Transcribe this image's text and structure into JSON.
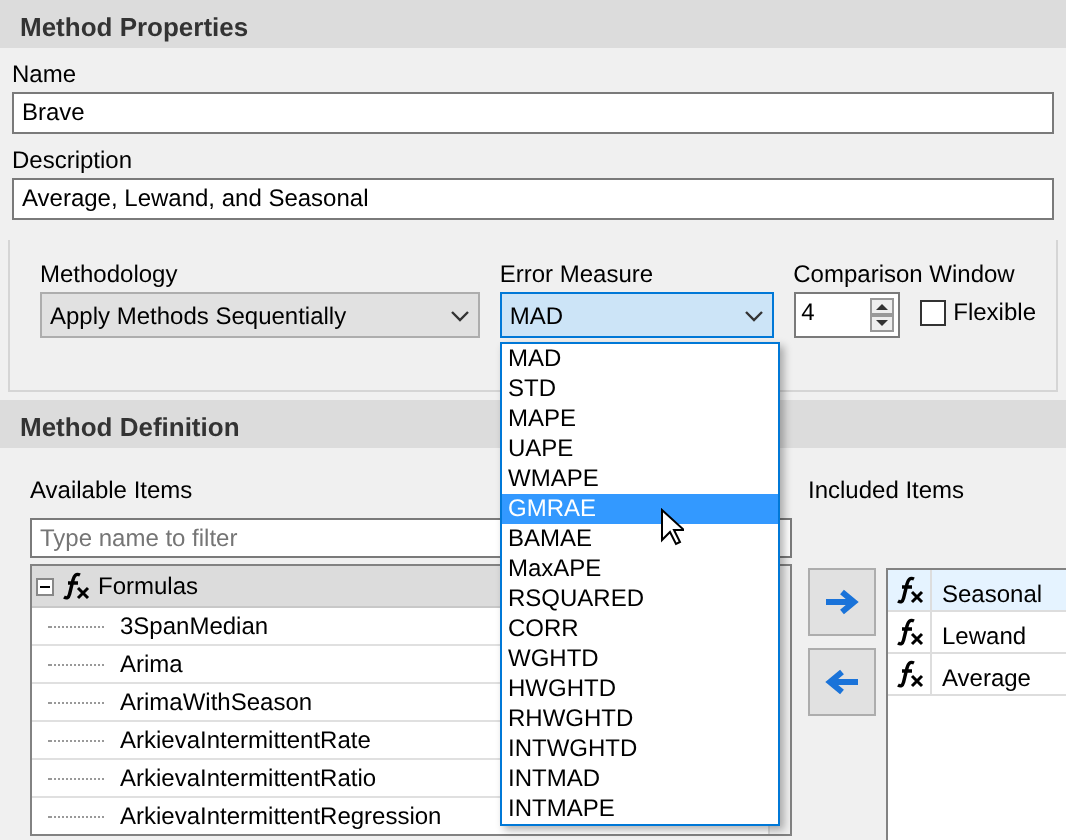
{
  "properties": {
    "title": "Method Properties",
    "name": {
      "label": "Name",
      "value": "Brave"
    },
    "description": {
      "label": "Description",
      "value": "Average, Lewand, and Seasonal"
    },
    "methodology": {
      "label": "Methodology",
      "value": "Apply Methods Sequentially"
    },
    "error_measure": {
      "label": "Error Measure",
      "value": "MAD",
      "expanded": true,
      "options": [
        {
          "label": "MAD",
          "highlighted": false
        },
        {
          "label": "STD",
          "highlighted": false
        },
        {
          "label": "MAPE",
          "highlighted": false
        },
        {
          "label": "UAPE",
          "highlighted": false
        },
        {
          "label": "WMAPE",
          "highlighted": false
        },
        {
          "label": "GMRAE",
          "highlighted": true
        },
        {
          "label": "BAMAE",
          "highlighted": false
        },
        {
          "label": "MaxAPE",
          "highlighted": false
        },
        {
          "label": "RSQUARED",
          "highlighted": false
        },
        {
          "label": "CORR",
          "highlighted": false
        },
        {
          "label": "WGHTD",
          "highlighted": false
        },
        {
          "label": "HWGHTD",
          "highlighted": false
        },
        {
          "label": "RHWGHTD",
          "highlighted": false
        },
        {
          "label": "INTWGHTD",
          "highlighted": false
        },
        {
          "label": "INTMAD",
          "highlighted": false
        },
        {
          "label": "INTMAPE",
          "highlighted": false
        }
      ]
    },
    "comparison_window": {
      "label": "Comparison Window",
      "value": "4"
    },
    "flexible": {
      "label": "Flexible",
      "checked": false
    }
  },
  "definition": {
    "title": "Method Definition",
    "available": {
      "label": "Available Items",
      "placeholder": "Type name to filter",
      "tree": [
        {
          "label": "Formulas",
          "expanded": true,
          "children": [
            {
              "label": "3SpanMedian"
            },
            {
              "label": "Arima"
            },
            {
              "label": "ArimaWithSeason"
            },
            {
              "label": "ArkievaIntermittentRate"
            },
            {
              "label": "ArkievaIntermittentRatio"
            },
            {
              "label": "ArkievaIntermittentRegression"
            }
          ]
        }
      ]
    },
    "included": {
      "label": "Included Items",
      "rows": [
        {
          "label": "Seasonal",
          "selected": true
        },
        {
          "label": "Lewand",
          "selected": false
        },
        {
          "label": "Average",
          "selected": false
        }
      ]
    }
  }
}
